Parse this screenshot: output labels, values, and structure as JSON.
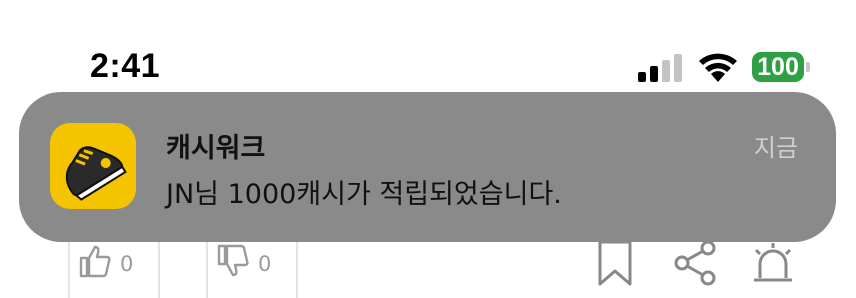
{
  "status_bar": {
    "time": "2:41",
    "battery_level": "100",
    "battery_color": "#2ea043",
    "signal_bars_active": 2,
    "signal_bars_total": 4
  },
  "notification": {
    "app_name": "캐시워크",
    "message": "JN님 1000캐시가 적립되었습니다.",
    "time": "지금",
    "app_icon": "sneaker-icon",
    "app_icon_color": "#f5c400",
    "background_color": "#8a8a8a"
  },
  "bottom_bar": {
    "like_count": "0",
    "dislike_count": "0",
    "icons": [
      "thumbs-up-icon",
      "thumbs-down-icon",
      "bookmark-icon",
      "share-icon",
      "alarm-icon"
    ]
  }
}
